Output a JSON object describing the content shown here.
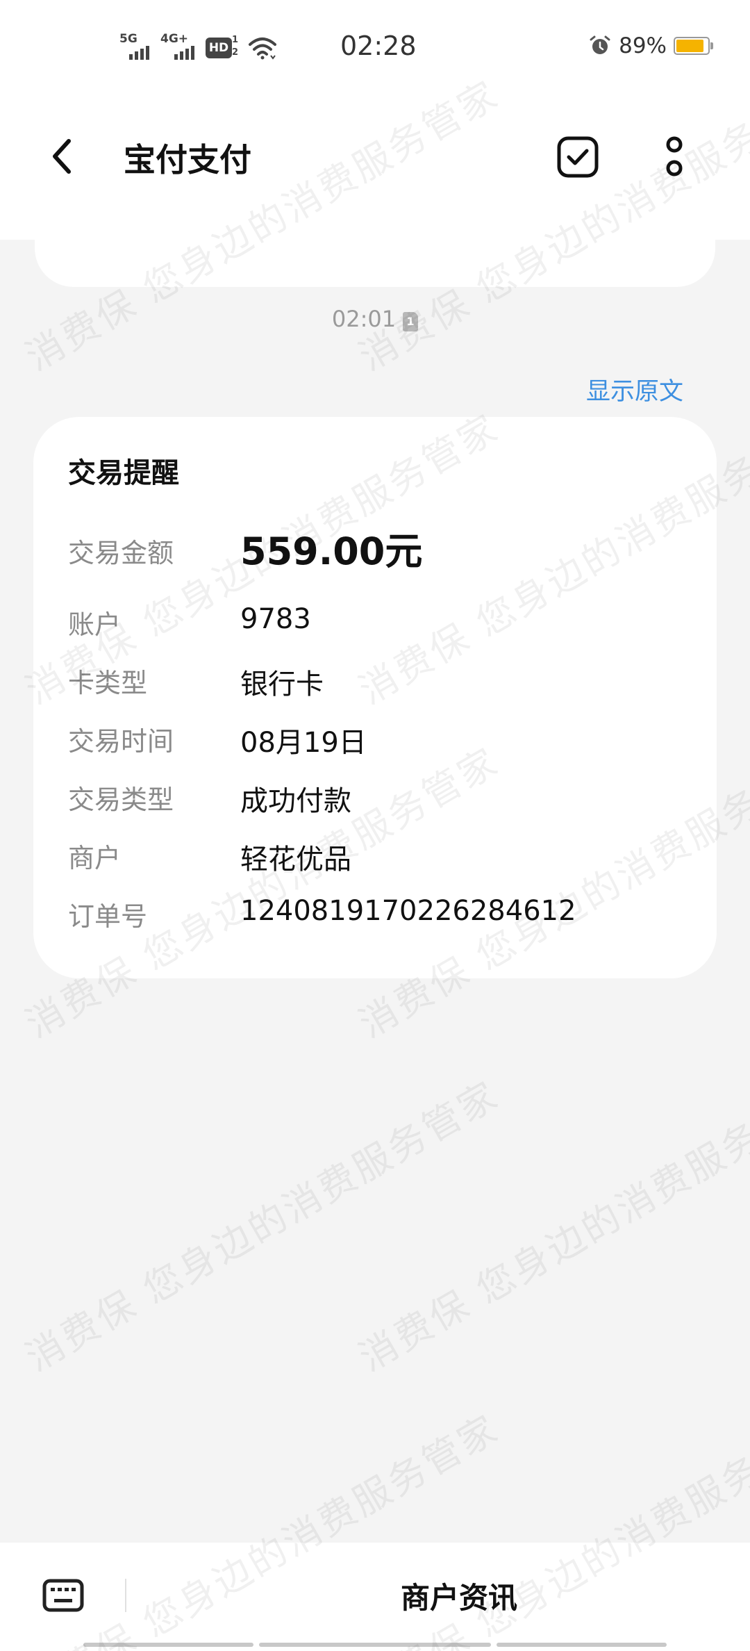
{
  "status_bar": {
    "network_1": "5G",
    "network_2": "4G+",
    "hd_label": "HD",
    "hd_sub_1": "1",
    "hd_sub_2": "2",
    "time": "02:28",
    "battery_percent": "89%",
    "battery_level": 0.89,
    "battery_color": "#f5b300"
  },
  "header": {
    "title": "宝付支付",
    "back_icon": "chevron-left-icon",
    "check_icon": "checkbox-checked-icon",
    "more_icon": "more-vertical-icon"
  },
  "message": {
    "time": "02:01",
    "sim_badge": "1",
    "show_original": "显示原文",
    "card": {
      "title": "交易提醒",
      "rows": [
        {
          "key": "交易金额",
          "value": "559.00元"
        },
        {
          "key": "账户",
          "value": "9783"
        },
        {
          "key": "卡类型",
          "value": "银行卡"
        },
        {
          "key": "交易时间",
          "value": "08月19日"
        },
        {
          "key": "交易类型",
          "value": "成功付款"
        },
        {
          "key": "商户",
          "value": "轻花优品"
        },
        {
          "key": "订单号",
          "value": "1240819170226284612"
        }
      ]
    }
  },
  "bottom_bar": {
    "keyboard_icon": "keyboard-icon",
    "menu_label": "商户资讯"
  },
  "watermark": {
    "text": "消费保 您身边的消费服务管家"
  },
  "colors": {
    "link": "#3d8fe0",
    "background": "#f4f4f4",
    "card": "#ffffff"
  }
}
